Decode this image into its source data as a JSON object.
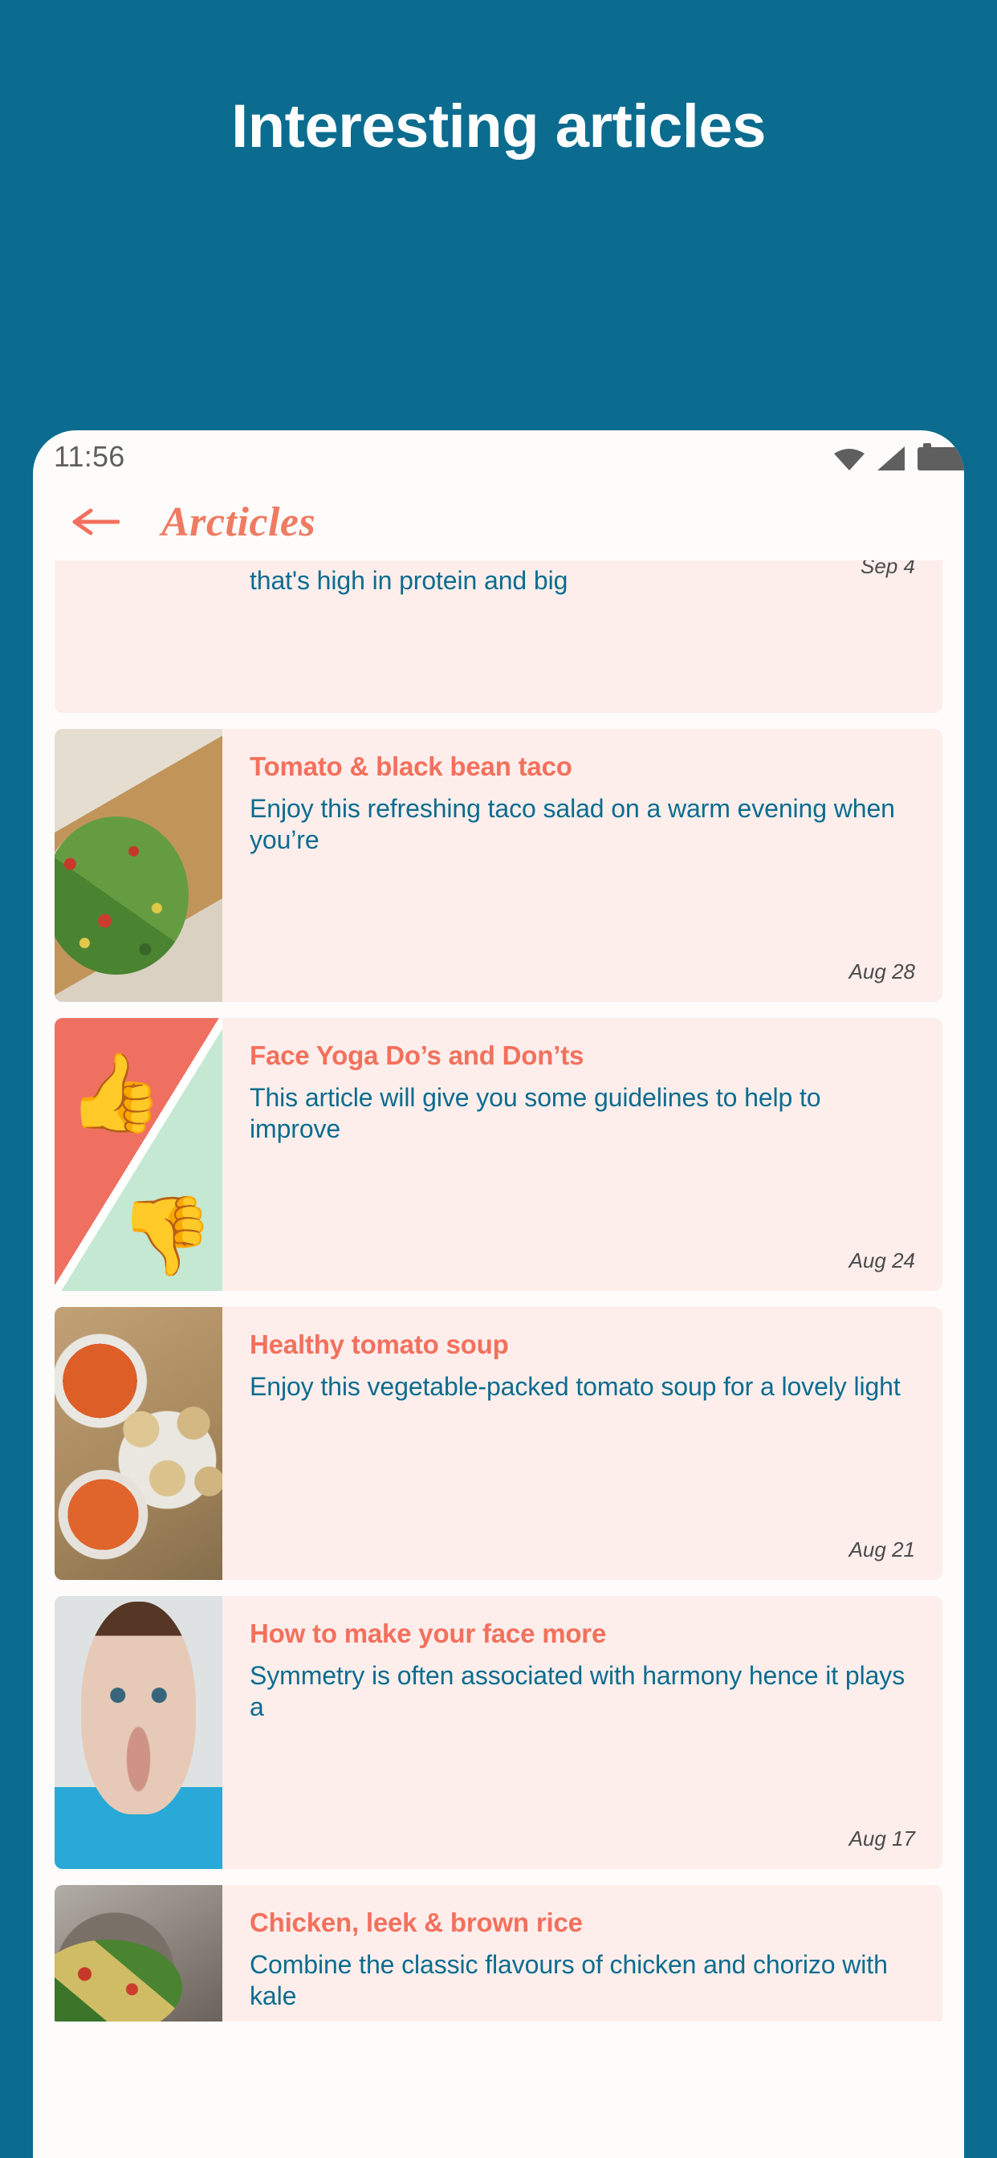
{
  "promo": {
    "headline": "Interesting articles",
    "background_color": "#0b6c8f"
  },
  "statusbar": {
    "clock": "11:56",
    "icons": [
      "wifi-icon",
      "cellular-signal-icon",
      "battery-icon"
    ]
  },
  "appbar": {
    "back_icon": "back-arrow-icon",
    "title": "Arcticles",
    "title_color": "#f07a62"
  },
  "theme": {
    "accent": "#f3705c",
    "body_text": "#0b6c8f",
    "card_bg": "#fdeeec",
    "screen_bg": "#fdfcfa",
    "date_text": "#4b4b4b"
  },
  "articles": [
    {
      "title": "",
      "desc": "that's high in protein and big",
      "date": "Sep 4",
      "thumb": "chicken-salad-photo",
      "clipped": "top"
    },
    {
      "title": "Tomato & black bean taco",
      "desc": "Enjoy this refreshing taco salad on a warm evening when you’re",
      "date": "Aug 28",
      "thumb": "taco-salad-photo",
      "clipped": "none"
    },
    {
      "title": "Face Yoga Do’s and Don’ts",
      "desc": "This article will give you some guidelines to help to improve",
      "date": "Aug 24",
      "thumb": "thumbs-up-down-photo",
      "clipped": "none"
    },
    {
      "title": "Healthy tomato soup",
      "desc": "Enjoy this vegetable-packed tomato soup for a lovely light",
      "date": "Aug 21",
      "thumb": "tomato-soup-photo",
      "clipped": "none"
    },
    {
      "title": "How to make your face more",
      "desc": "Symmetry is often associated with harmony hence it plays a",
      "date": "Aug 17",
      "thumb": "face-portrait-photo",
      "clipped": "none"
    },
    {
      "title": "Chicken, leek & brown rice",
      "desc": "Combine the classic flavours of chicken and chorizo with kale",
      "date": "",
      "thumb": "chicken-rice-photo",
      "clipped": "bottom"
    }
  ]
}
